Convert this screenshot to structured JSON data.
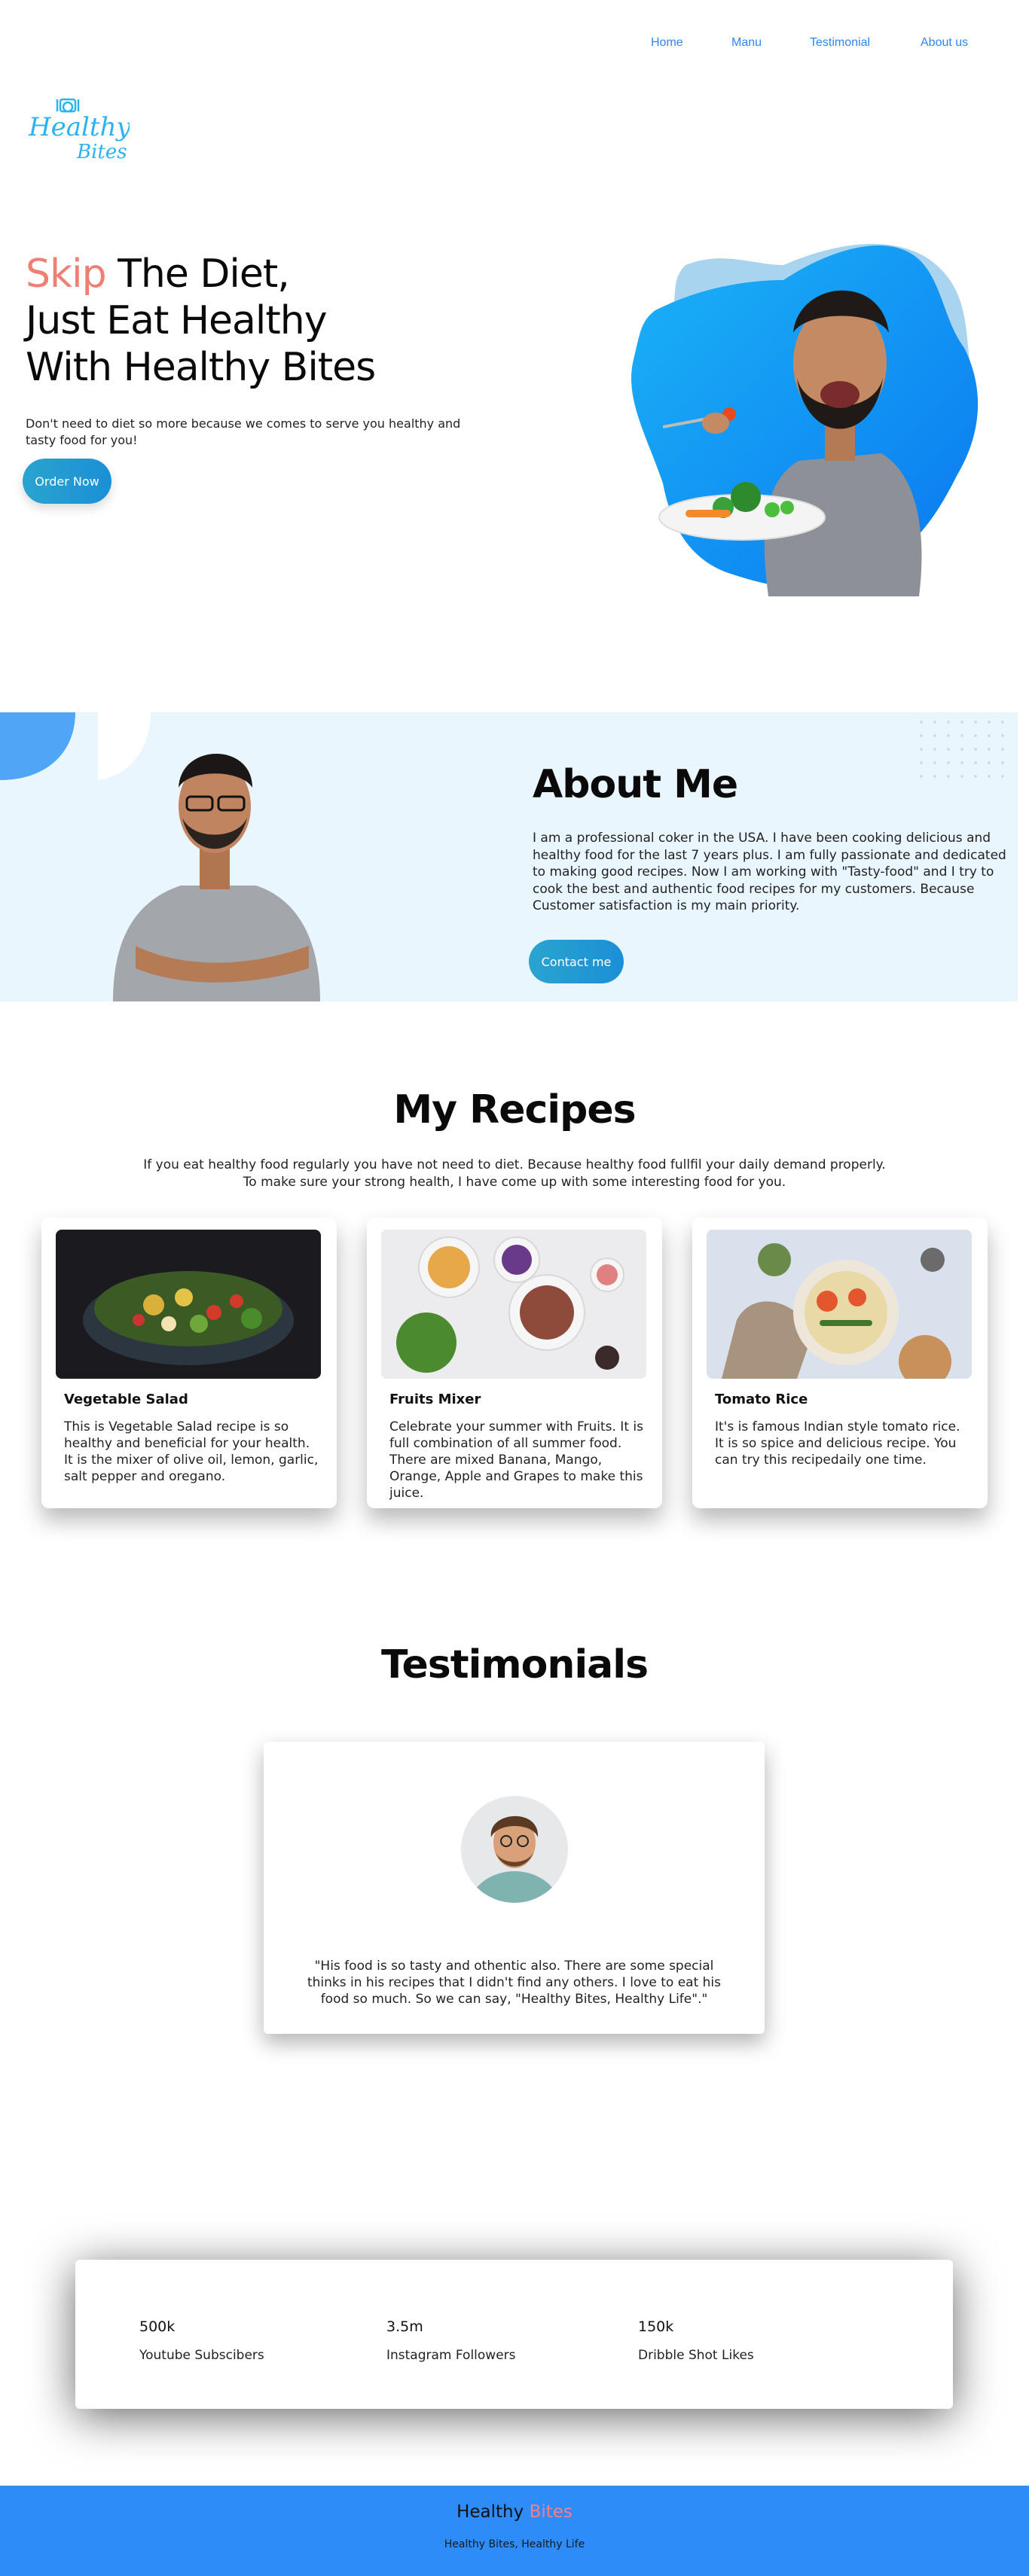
{
  "nav": {
    "items": [
      {
        "label": "Home"
      },
      {
        "label": "Manu"
      },
      {
        "label": "Testimonial"
      },
      {
        "label": "About us"
      }
    ]
  },
  "logo": {
    "line1": "Healthy",
    "line2": "Bites",
    "icon": "chef-hat-icon",
    "color": "#2bb3f0"
  },
  "hero": {
    "title_accent": "Skip",
    "title_line1_rest": " The Diet,",
    "title_line2": "Just Eat Healthy",
    "title_line3": "With Healthy Bites",
    "subtitle": "Don't need to diet so more because we comes to serve you healthy and tasty food for you!",
    "button": "Order  Now",
    "accent_color": "#ef7f72"
  },
  "about": {
    "title": "About Me",
    "text": "I am a professional coker in the USA. I have been cooking delicious and healthy food for the last 7 years plus. I am fully passionate and dedicated to making good recipes. Now I am working with \"Tasty-food\" and I try to cook the best and authentic food recipes for my customers. Because Customer satisfaction is my main priority.",
    "button": "Contact  me",
    "background": "#eaf6fe"
  },
  "recipes": {
    "title": "My Recipes",
    "intro_line1": "If you eat healthy food regularly you have not need to diet. Because healthy food fullfil your daily demand properly.",
    "intro_line2": "To make sure your strong health, I have come up with some interesting food for you.",
    "cards": [
      {
        "title": "Vegetable Salad",
        "text": "This is Vegetable Salad recipe is so healthy and beneficial for your health. It is the mixer of olive oil, lemon, garlic, salt pepper and oregano."
      },
      {
        "title": "Fruits Mixer",
        "text": "Celebrate your summer with Fruits. It is full combination of all summer food. There are mixed Banana, Mango, Orange, Apple and Grapes to make this juice."
      },
      {
        "title": "Tomato Rice",
        "text": "It's is famous Indian style tomato rice. It is so spice and delicious recipe. You can try this recipedaily one time."
      }
    ]
  },
  "testimonials": {
    "title": "Testimonials",
    "quote": "\"His food is so tasty and othentic also. There are some special thinks in his recipes that I didn't find any others. I love to eat his food so much. So we can say, \"Healthy Bites, Healthy Life\".\""
  },
  "stats": [
    {
      "value": "500k",
      "label": "Youtube Subscibers"
    },
    {
      "value": "3.5m",
      "label": "Instagram Followers"
    },
    {
      "value": "150k",
      "label": "Dribble Shot Likes"
    }
  ],
  "footer": {
    "brand_main": "Healthy ",
    "brand_accent": "Bites",
    "tagline": "Healthy Bites, Healthy Life",
    "background": "#2d8cf7"
  }
}
